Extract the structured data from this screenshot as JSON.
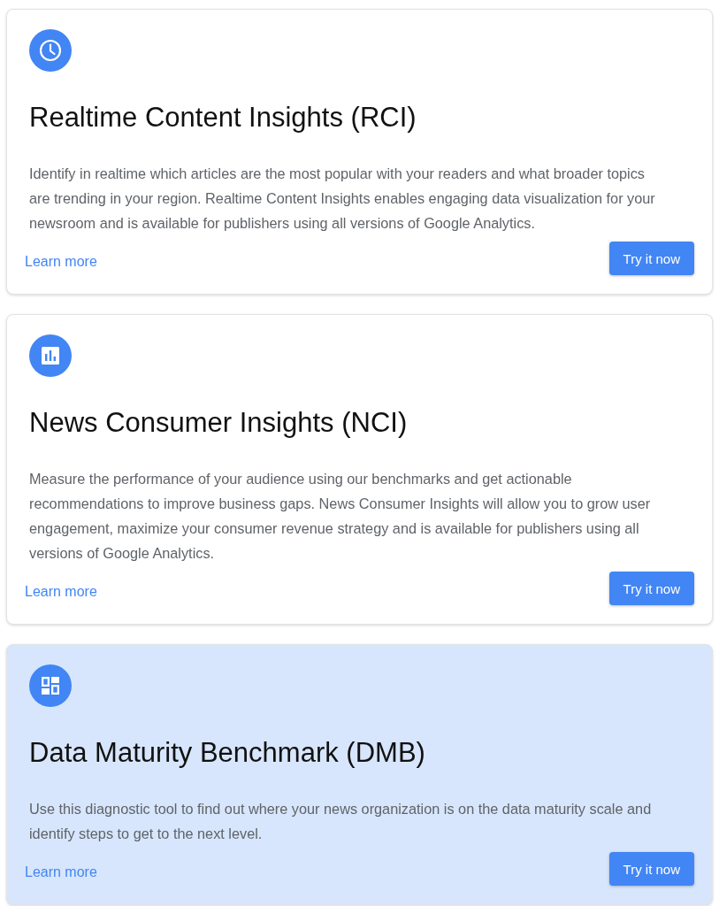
{
  "cards": [
    {
      "title": "Realtime Content Insights (RCI)",
      "description": "Identify in realtime which articles are the most popular with your readers and what broader topics are trending in your region. Realtime Content Insights enables engaging data visualization for your newsroom and is available for publishers using all versions of Google Analytics.",
      "link": "Learn more",
      "button": "Try it now",
      "highlighted": false
    },
    {
      "title": "News Consumer Insights (NCI)",
      "description": "Measure the performance of your audience using our benchmarks and get actionable recommendations to improve business gaps. News Consumer Insights will allow you to grow user engagement, maximize your consumer revenue strategy and is available for publishers using all versions of Google Analytics.",
      "link": "Learn more",
      "button": "Try it now",
      "highlighted": false
    },
    {
      "title": "Data Maturity Benchmark (DMB)",
      "description": "Use this diagnostic tool to find out where your news organization is on the data maturity scale and identify steps to get to the next level.",
      "link": "Learn more",
      "button": "Try it now",
      "highlighted": true
    }
  ]
}
